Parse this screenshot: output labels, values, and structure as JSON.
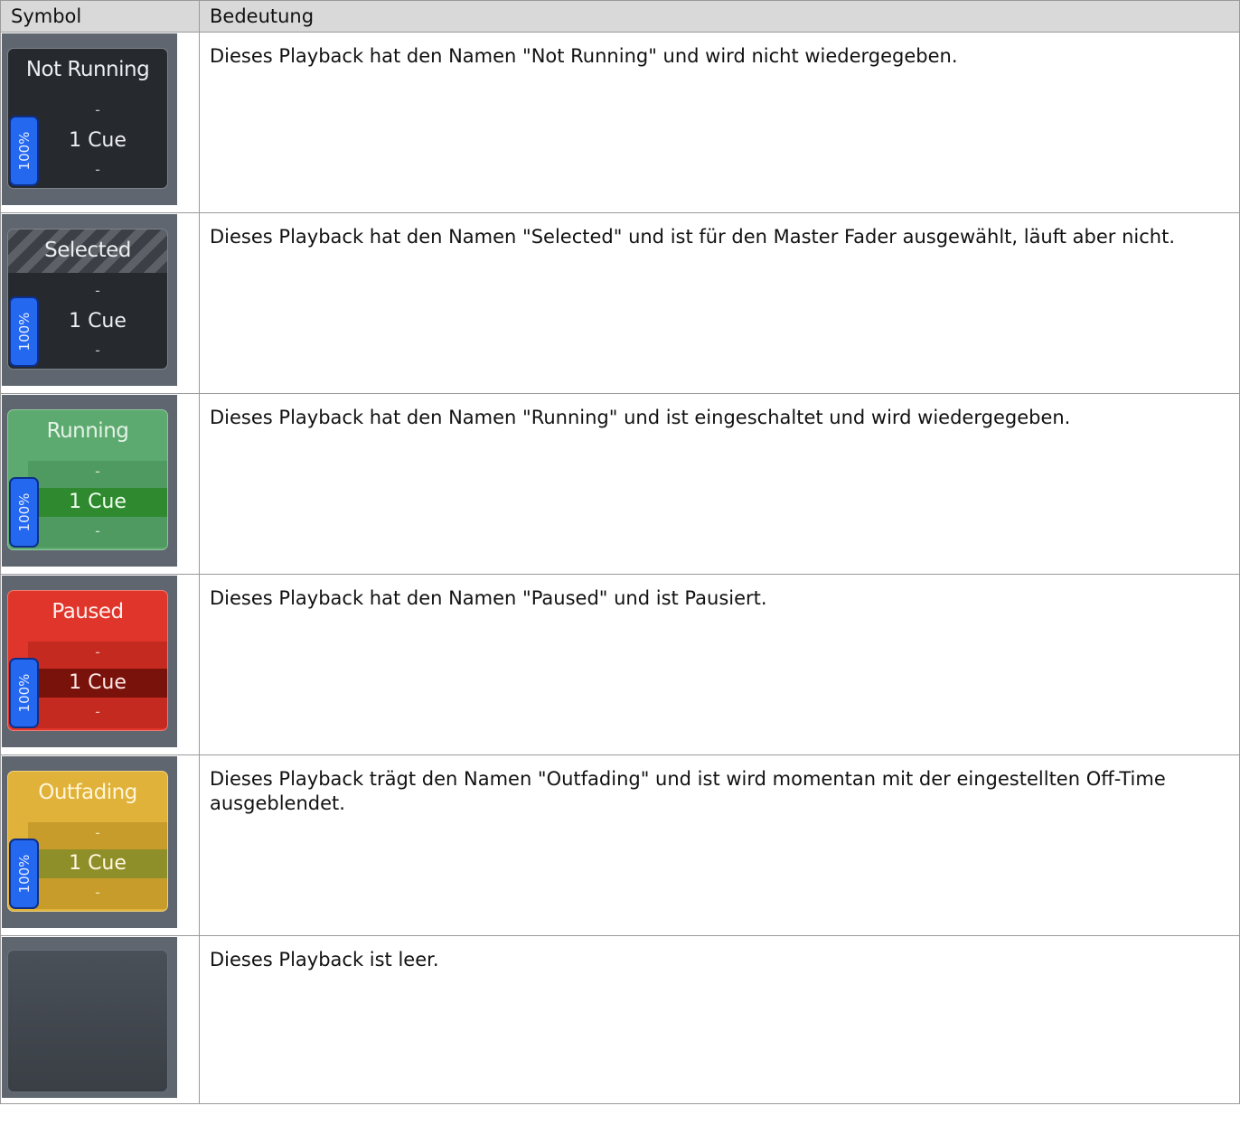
{
  "headers": {
    "symbol": "Symbol",
    "meaning": "Bedeutung"
  },
  "rows": [
    {
      "tile": {
        "name": "Not Running",
        "percent": "100%",
        "cue": "1 Cue",
        "prev": "-",
        "next": "-",
        "state": "not-running"
      },
      "description": "Dieses Playback hat den Namen \"Not Running\" und wird nicht wiedergegeben."
    },
    {
      "tile": {
        "name": "Selected",
        "percent": "100%",
        "cue": "1 Cue",
        "prev": "-",
        "next": "-",
        "state": "selected"
      },
      "description": "Dieses Playback hat den Namen \"Selected\" und ist für den Master Fader ausgewählt, läuft aber nicht."
    },
    {
      "tile": {
        "name": "Running",
        "percent": "100%",
        "cue": "1 Cue",
        "prev": "-",
        "next": "-",
        "state": "running"
      },
      "description": "Dieses Playback hat den Namen \"Running\" und ist eingeschaltet und wird wiedergegeben."
    },
    {
      "tile": {
        "name": "Paused",
        "percent": "100%",
        "cue": "1 Cue",
        "prev": "-",
        "next": "-",
        "state": "paused"
      },
      "description": "Dieses Playback hat den Namen \"Paused\" und ist Pausiert."
    },
    {
      "tile": {
        "name": "Outfading",
        "percent": "100%",
        "cue": "1 Cue",
        "prev": "-",
        "next": "-",
        "state": "outfading"
      },
      "description": "Dieses Playback trägt den Namen \"Outfading\" und ist wird momentan mit der eingestellten Off-Time ausgeblendet."
    },
    {
      "tile": {
        "state": "empty"
      },
      "description": "Dieses Playback ist leer."
    }
  ],
  "colors": {
    "header_bg": "#d9d9d9",
    "tile_bg": "#5f6670",
    "percent_badge": "#2468f0",
    "running": "#5daa70",
    "paused": "#e0352a",
    "outfading": "#e0b23a"
  }
}
